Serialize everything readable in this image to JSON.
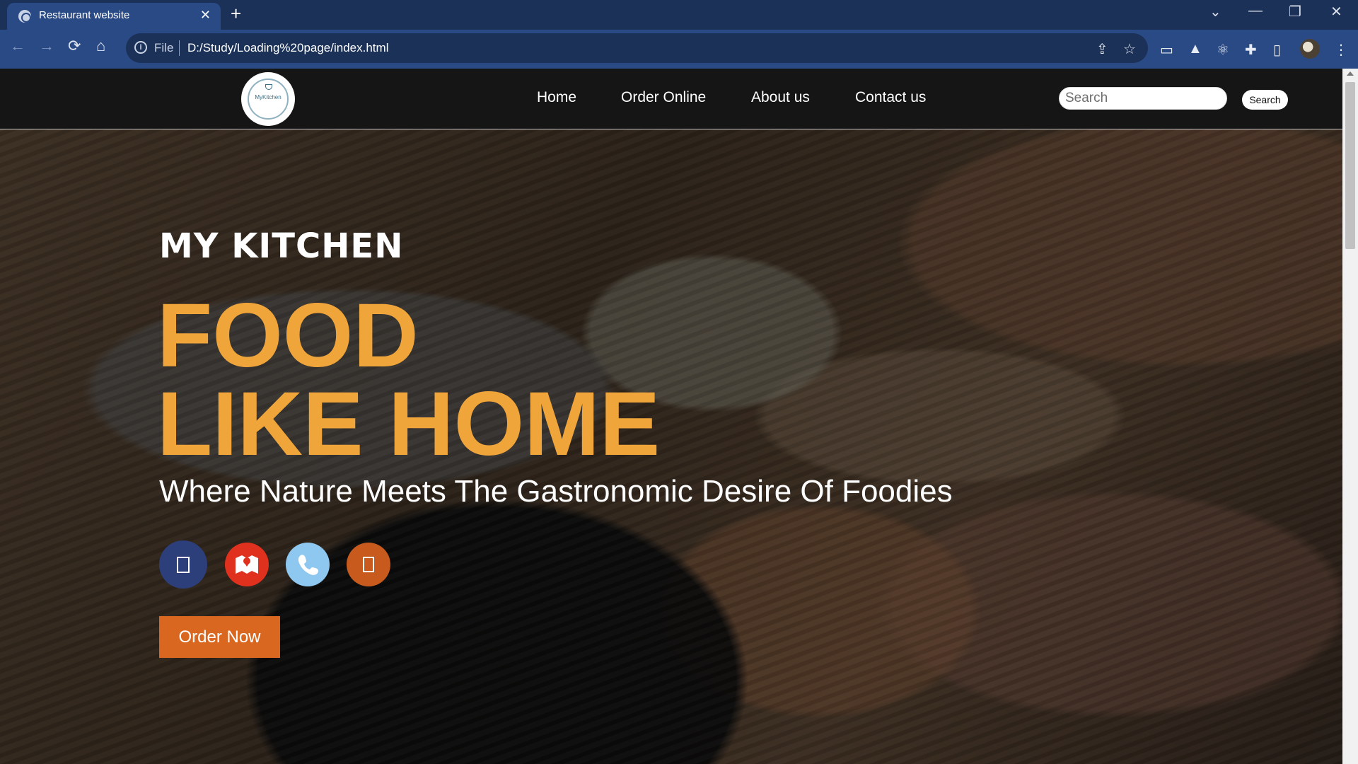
{
  "browser": {
    "tab_title": "Restaurant website",
    "tab_close": "✕",
    "new_tab": "+",
    "address_scheme": "File",
    "address_url": "D:/Study/Loading%20page/index.html",
    "window_controls": {
      "tab_search": "⌄",
      "minimize": "—",
      "restore": "❐",
      "close": "✕"
    }
  },
  "site": {
    "logo_text": "MyKitchen",
    "nav": [
      "Home",
      "Order Online",
      "About us",
      "Contact us"
    ],
    "search_placeholder": "Search",
    "search_button": "Search"
  },
  "hero": {
    "brand": "MY KITCHEN",
    "headline_1": "FOOD",
    "headline_2": "LIKE HOME",
    "subtitle": "Where Nature Meets The Gastronomic Desire Of Foodies",
    "social": [
      {
        "name": "facebook-icon",
        "color": "#2d3f7a"
      },
      {
        "name": "map-icon",
        "color": "#e0301e"
      },
      {
        "name": "phone-icon",
        "color": "#8ec7ef"
      },
      {
        "name": "instagram-icon",
        "color": "#c85a1e"
      }
    ],
    "cta": "Order Now"
  },
  "colors": {
    "accent": "#f0a53a",
    "button": "#d9671f",
    "nav_bg": "#151515",
    "chrome": "#2a4a85"
  }
}
